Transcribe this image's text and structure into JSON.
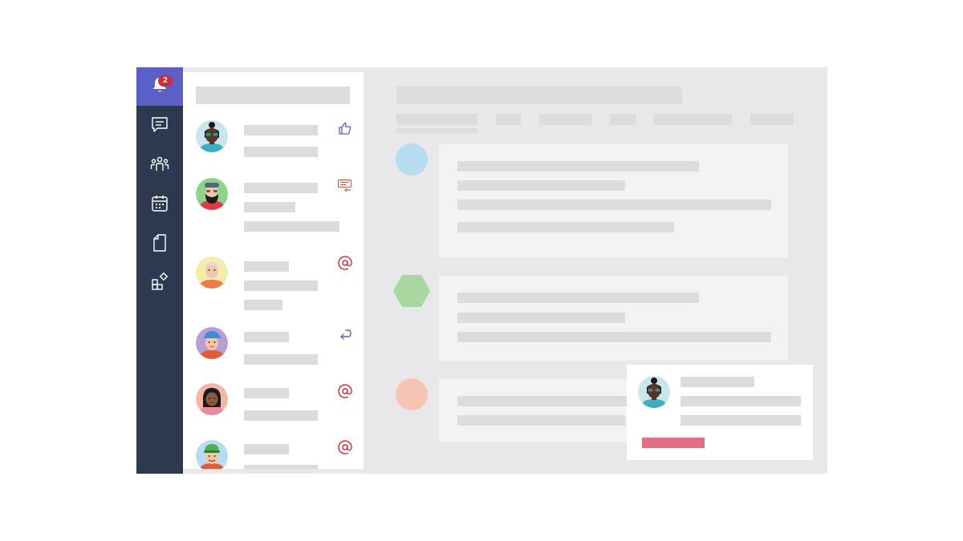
{
  "rail": {
    "items": [
      {
        "name": "activity",
        "icon": "bell-icon",
        "badge": "2",
        "active": true
      },
      {
        "name": "chat",
        "icon": "chat-icon"
      },
      {
        "name": "teams",
        "icon": "teams-icon"
      },
      {
        "name": "calendar",
        "icon": "calendar-icon"
      },
      {
        "name": "files",
        "icon": "file-icon"
      },
      {
        "name": "apps",
        "icon": "apps-icon"
      }
    ]
  },
  "feed": {
    "items": [
      {
        "avatar": "avatar-woman-sunglasses",
        "activity_icon": "thumbs-up-icon",
        "activity_color": "#5b5fc7"
      },
      {
        "avatar": "avatar-bearded-man",
        "activity_icon": "message-reply-icon",
        "activity_color": "#e35b3d"
      },
      {
        "avatar": "avatar-older-man",
        "activity_icon": "at-mention-icon",
        "activity_color": "#cc2b3a"
      },
      {
        "avatar": "avatar-man-cap",
        "activity_icon": "reply-icon",
        "activity_color": "#5b5fc7"
      },
      {
        "avatar": "avatar-woman",
        "activity_icon": "at-mention-icon",
        "activity_color": "#cc2b3a"
      },
      {
        "avatar": "avatar-man-green-hat",
        "activity_icon": "at-mention-icon",
        "activity_color": "#cc2b3a"
      }
    ]
  },
  "colors": {
    "rail_bg": "#2c3950",
    "rail_active": "#5b5fc7",
    "badge": "#cc2b3a",
    "placeholder": "#dcdcde",
    "card_bg": "#f3f3f4",
    "post_avatar_1": "#b8dcef",
    "post_avatar_2": "#a8d8a0",
    "post_avatar_3": "#f7c4b3",
    "popup_button": "#e26f83"
  }
}
